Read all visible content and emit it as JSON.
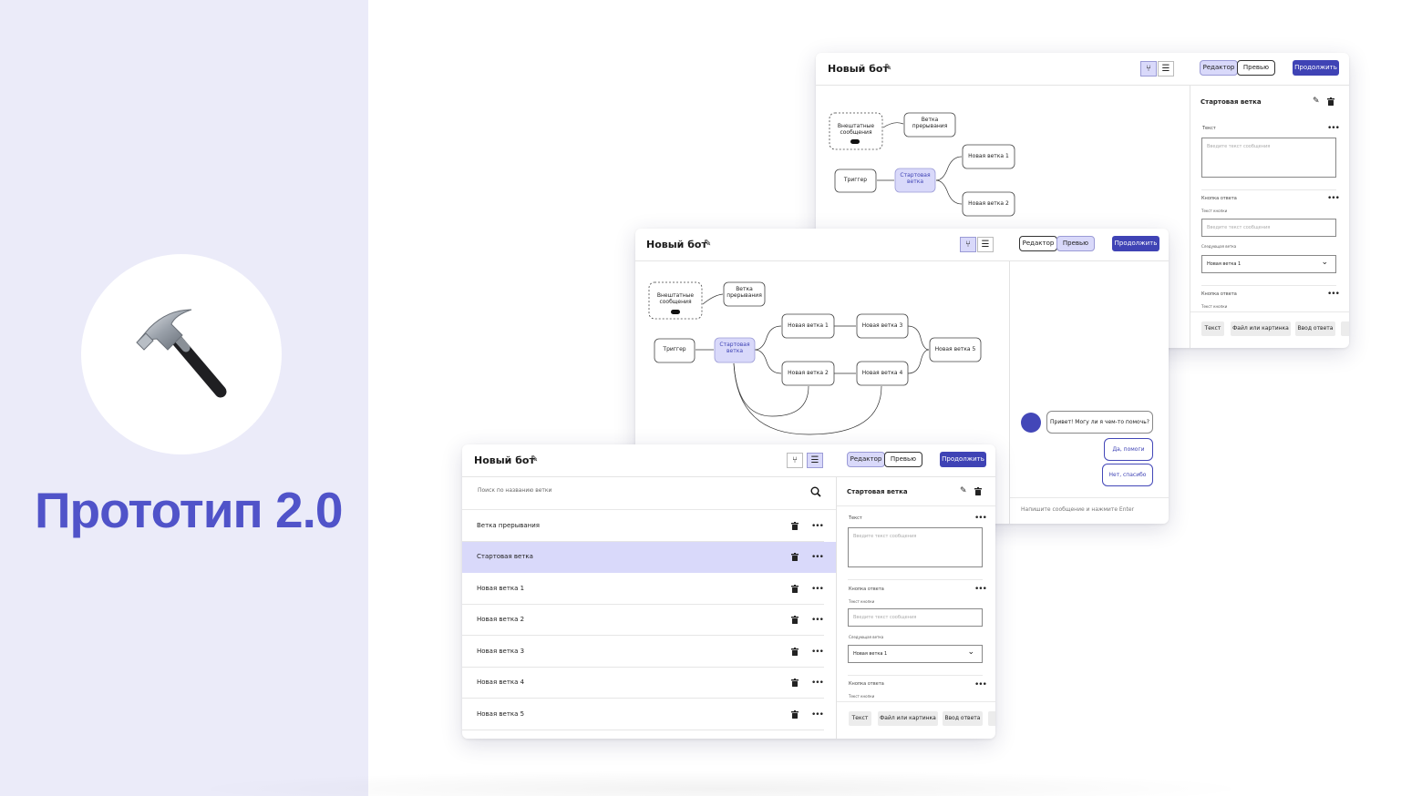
{
  "slide": {
    "title": "Прототип 2.0",
    "icon": "hammer-icon"
  },
  "colors": {
    "accent": "#3f43b5",
    "selection": "#d9d9fa",
    "title": "#5053c9",
    "panel_bg": "#ebebf9"
  },
  "app": {
    "bot_name": "Новый бот",
    "editor_label": "Редактор",
    "preview_label": "Превью",
    "continue_label": "Продолжить"
  },
  "flow_back": {
    "nodes": {
      "emergency": "Внештатные сообщения",
      "interrupt": "Ветка прерывания",
      "trigger": "Триггер",
      "start": "Стартовая ветка",
      "b1": "Новая ветка 1",
      "b2": "Новая ветка 2"
    }
  },
  "flow_mid": {
    "nodes": {
      "emergency": "Внештатные сообщения",
      "interrupt": "Ветка прерывания",
      "trigger": "Триггер",
      "start": "Стартовая ветка",
      "b1": "Новая ветка 1",
      "b2": "Новая ветка 2",
      "b3": "Новая ветка 3",
      "b4": "Новая ветка 4",
      "b5": "Новая ветка 5"
    }
  },
  "editor": {
    "title": "Стартовая ветка",
    "text_label": "Текст",
    "text_placeholder": "Введите текст сообщения",
    "reply_button_label": "Кнопка ответа",
    "button_text_label": "Текст кнопки",
    "button_text_placeholder": "Введите текст сообщения",
    "next_branch_label": "Следующая ветка",
    "next_branch_value": "Новая ветка 1",
    "reply_button_label_2": "Кнопка ответа",
    "button_text_label_2": "Текст кнопки",
    "add_buttons": [
      "Текст",
      "Файл или картинка",
      "Ввод ответа"
    ]
  },
  "chat": {
    "greeting": "Привет! Могу ли я чем-то помочь?",
    "replies": [
      "Да, помоги",
      "Нет, спасибо"
    ],
    "input_placeholder": "Напишите сообщение и нажмите Enter"
  },
  "list": {
    "search_placeholder": "Поиск по названию ветки",
    "items": [
      "Ветка прерывания",
      "Стартовая ветка",
      "Новая ветка 1",
      "Новая ветка 2",
      "Новая ветка 3",
      "Новая ветка 4",
      "Новая ветка 5"
    ],
    "selected_index": 1
  }
}
